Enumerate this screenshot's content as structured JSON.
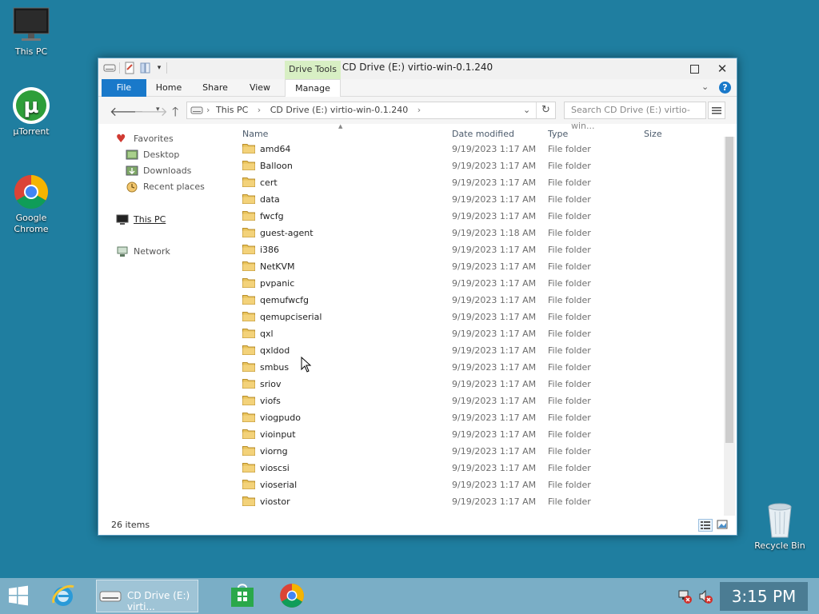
{
  "desktop": {
    "icons": [
      {
        "label": "This PC"
      },
      {
        "label": "µTorrent"
      },
      {
        "label": "Google Chrome"
      },
      {
        "label": "Recycle Bin"
      }
    ]
  },
  "window": {
    "title": "CD Drive (E:) virtio-win-0.1.240",
    "context_tab": "Drive Tools",
    "ribbon_tabs": [
      "File",
      "Home",
      "Share",
      "View",
      "Manage"
    ],
    "address": {
      "segments": [
        "This PC",
        "CD Drive (E:) virtio-win-0.1.240"
      ]
    },
    "search_placeholder": "Search CD Drive (E:) virtio-win...",
    "nav_pane": {
      "favorites": "Favorites",
      "desktop": "Desktop",
      "downloads": "Downloads",
      "recent": "Recent places",
      "this_pc": "This PC",
      "network": "Network"
    },
    "columns": {
      "name": "Name",
      "date": "Date modified",
      "type": "Type",
      "size": "Size"
    },
    "files": [
      {
        "name": "amd64",
        "date": "9/19/2023 1:17 AM",
        "type": "File folder"
      },
      {
        "name": "Balloon",
        "date": "9/19/2023 1:17 AM",
        "type": "File folder"
      },
      {
        "name": "cert",
        "date": "9/19/2023 1:17 AM",
        "type": "File folder"
      },
      {
        "name": "data",
        "date": "9/19/2023 1:17 AM",
        "type": "File folder"
      },
      {
        "name": "fwcfg",
        "date": "9/19/2023 1:17 AM",
        "type": "File folder"
      },
      {
        "name": "guest-agent",
        "date": "9/19/2023 1:18 AM",
        "type": "File folder"
      },
      {
        "name": "i386",
        "date": "9/19/2023 1:17 AM",
        "type": "File folder"
      },
      {
        "name": "NetKVM",
        "date": "9/19/2023 1:17 AM",
        "type": "File folder"
      },
      {
        "name": "pvpanic",
        "date": "9/19/2023 1:17 AM",
        "type": "File folder"
      },
      {
        "name": "qemufwcfg",
        "date": "9/19/2023 1:17 AM",
        "type": "File folder"
      },
      {
        "name": "qemupciserial",
        "date": "9/19/2023 1:17 AM",
        "type": "File folder"
      },
      {
        "name": "qxl",
        "date": "9/19/2023 1:17 AM",
        "type": "File folder"
      },
      {
        "name": "qxldod",
        "date": "9/19/2023 1:17 AM",
        "type": "File folder"
      },
      {
        "name": "smbus",
        "date": "9/19/2023 1:17 AM",
        "type": "File folder"
      },
      {
        "name": "sriov",
        "date": "9/19/2023 1:17 AM",
        "type": "File folder"
      },
      {
        "name": "viofs",
        "date": "9/19/2023 1:17 AM",
        "type": "File folder"
      },
      {
        "name": "viogpudo",
        "date": "9/19/2023 1:17 AM",
        "type": "File folder"
      },
      {
        "name": "vioinput",
        "date": "9/19/2023 1:17 AM",
        "type": "File folder"
      },
      {
        "name": "viorng",
        "date": "9/19/2023 1:17 AM",
        "type": "File folder"
      },
      {
        "name": "vioscsi",
        "date": "9/19/2023 1:17 AM",
        "type": "File folder"
      },
      {
        "name": "vioserial",
        "date": "9/19/2023 1:17 AM",
        "type": "File folder"
      },
      {
        "name": "viostor",
        "date": "9/19/2023 1:17 AM",
        "type": "File folder"
      }
    ],
    "status": "26 items"
  },
  "taskbar": {
    "active_window": "CD Drive (E:) virti...",
    "clock": "3:15 PM"
  },
  "colors": {
    "desktop": "#1f7ea0",
    "taskbar": "#7aaec6",
    "file_tab": "#1979ca",
    "drive_tools": "#d8efc4",
    "folder": "#e8c35b"
  }
}
